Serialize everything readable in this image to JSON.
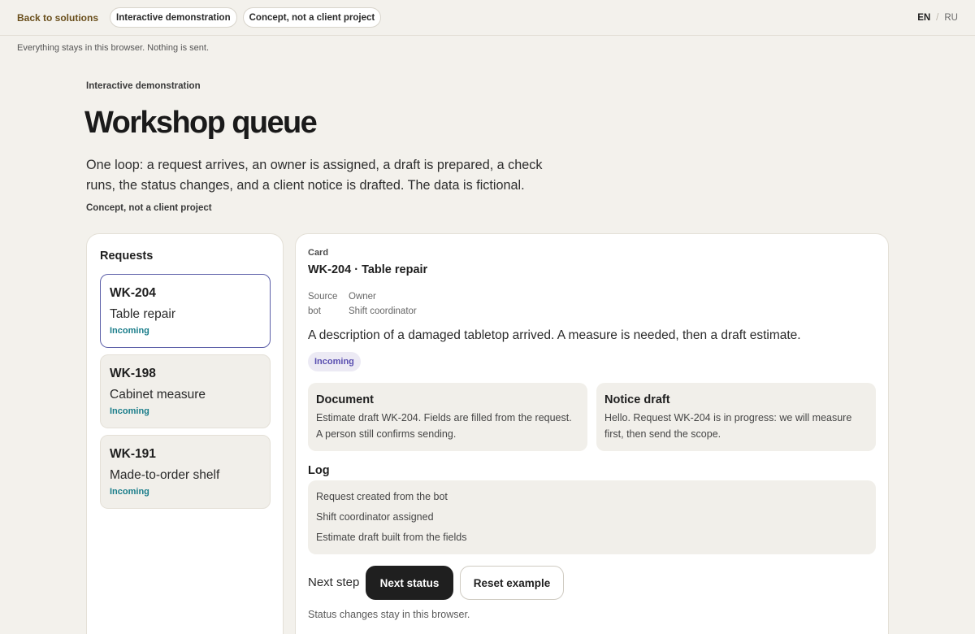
{
  "topbar": {
    "back_label": "Back to solutions",
    "pills": [
      "Interactive demonstration",
      "Concept, not a client project"
    ],
    "lang_active": "EN",
    "lang_separator": "/",
    "lang_other": "RU"
  },
  "privacy_note": "Everything stays in this browser. Nothing is sent.",
  "hero": {
    "eyebrow": "Interactive demonstration",
    "title": "Workshop queue",
    "lead": "One loop: a request arrives, an owner is assigned, a draft is prepared, a check runs, the status changes, and a client notice is drafted. The data is fictional.",
    "concept": "Concept, not a client project"
  },
  "requests": {
    "title": "Requests",
    "items": [
      {
        "id": "WK-204",
        "name": "Table repair",
        "status": "Incoming"
      },
      {
        "id": "WK-198",
        "name": "Cabinet measure",
        "status": "Incoming"
      },
      {
        "id": "WK-191",
        "name": "Made-to-order shelf",
        "status": "Incoming"
      }
    ]
  },
  "card": {
    "eyebrow": "Card",
    "title": "WK-204 · Table repair",
    "source_label": "Source",
    "source_value": "bot",
    "owner_label": "Owner",
    "owner_value": "Shift coordinator",
    "description": "A description of a damaged tabletop arrived. A measure is needed, then a draft estimate.",
    "status": "Incoming",
    "document": {
      "title": "Document",
      "text": "Estimate draft WK-204. Fields are filled from the request. A person still confirms sending."
    },
    "notice": {
      "title": "Notice draft",
      "text": "Hello. Request WK-204 is in progress: we will measure first, then send the scope."
    },
    "log_title": "Log",
    "log": [
      "Request created from the bot",
      "Shift coordinator assigned",
      "Estimate draft built from the fields"
    ],
    "next_step_label": "Next step",
    "next_button": "Next status",
    "reset_button": "Reset example",
    "status_note": "Status changes stay in this browser."
  },
  "colors": {
    "background": "#f3f1ec",
    "accent_link": "#6a4f1c",
    "status_teal": "#1a7d8a",
    "badge_purple": "#5a4fb0",
    "selected_border": "#5c5fa8"
  }
}
